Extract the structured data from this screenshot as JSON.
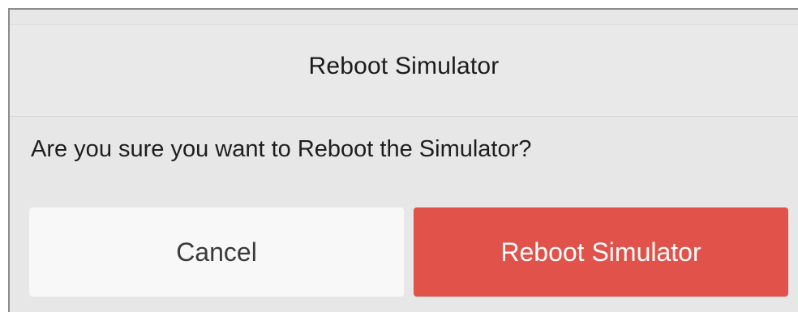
{
  "dialog": {
    "title": "Reboot Simulator",
    "message": "Are you sure you want to Reboot the Simulator?",
    "cancel_label": "Cancel",
    "confirm_label": "Reboot Simulator"
  },
  "colors": {
    "background": "#e7e7e7",
    "confirm_button": "#e0524a",
    "cancel_button": "#f8f8f8"
  }
}
